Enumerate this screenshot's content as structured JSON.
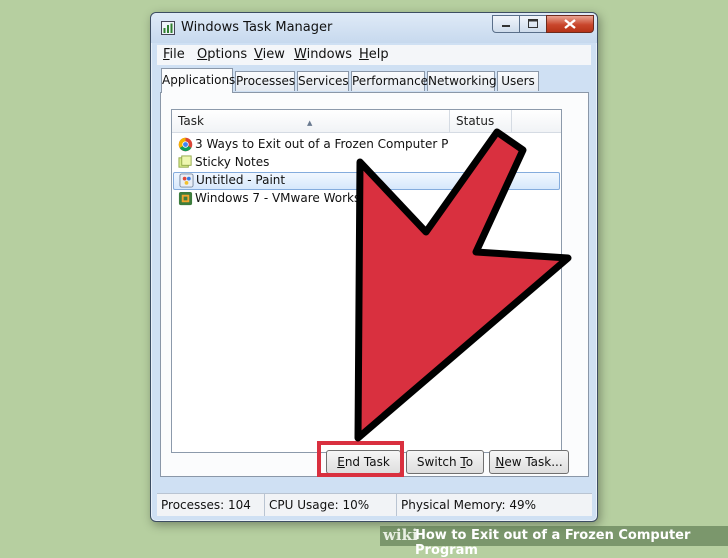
{
  "window": {
    "title": "Windows Task Manager"
  },
  "menu": [
    {
      "label": "File",
      "key": "F",
      "rest": "ile"
    },
    {
      "label": "Options",
      "key": "O",
      "rest": "ptions"
    },
    {
      "label": "View",
      "key": "V",
      "rest": "iew"
    },
    {
      "label": "Windows",
      "key": "W",
      "rest": "indows"
    },
    {
      "label": "Help",
      "key": "H",
      "rest": "elp"
    }
  ],
  "tabs": [
    {
      "label": "Applications",
      "active": true
    },
    {
      "label": "Processes",
      "active": false
    },
    {
      "label": "Services",
      "active": false
    },
    {
      "label": "Performance",
      "active": false
    },
    {
      "label": "Networking",
      "active": false
    },
    {
      "label": "Users",
      "active": false
    }
  ],
  "list": {
    "col_task": "Task",
    "col_status": "Status",
    "rows": [
      {
        "text": "3 Ways to Exit out of a Frozen Computer Progra...",
        "icon": "chrome-icon",
        "selected": false
      },
      {
        "text": "Sticky Notes",
        "icon": "sticky-notes-icon",
        "selected": false
      },
      {
        "text": "Untitled - Paint",
        "icon": "paint-icon",
        "selected": true
      },
      {
        "text": "Windows 7 - VMware Workstation",
        "icon": "vmware-icon",
        "selected": false
      }
    ]
  },
  "buttons": {
    "end_task_key": "E",
    "end_task_rest": "nd Task",
    "switch_to_pre": "Switch ",
    "switch_to_key": "T",
    "switch_to_rest": "o",
    "new_task_key": "N",
    "new_task_rest": "ew Task..."
  },
  "status": {
    "processes": "Processes: 104",
    "cpu": "CPU Usage: 10%",
    "memory": "Physical Memory: 49%"
  },
  "footer": {
    "wiki": "wiki",
    "title": "How to Exit out of a Frozen Computer Program"
  },
  "colors": {
    "background": "#b6cfa0",
    "arrow": "#d9303f",
    "highlight": "#d9303f",
    "window_frame": "#cfe0f3"
  }
}
